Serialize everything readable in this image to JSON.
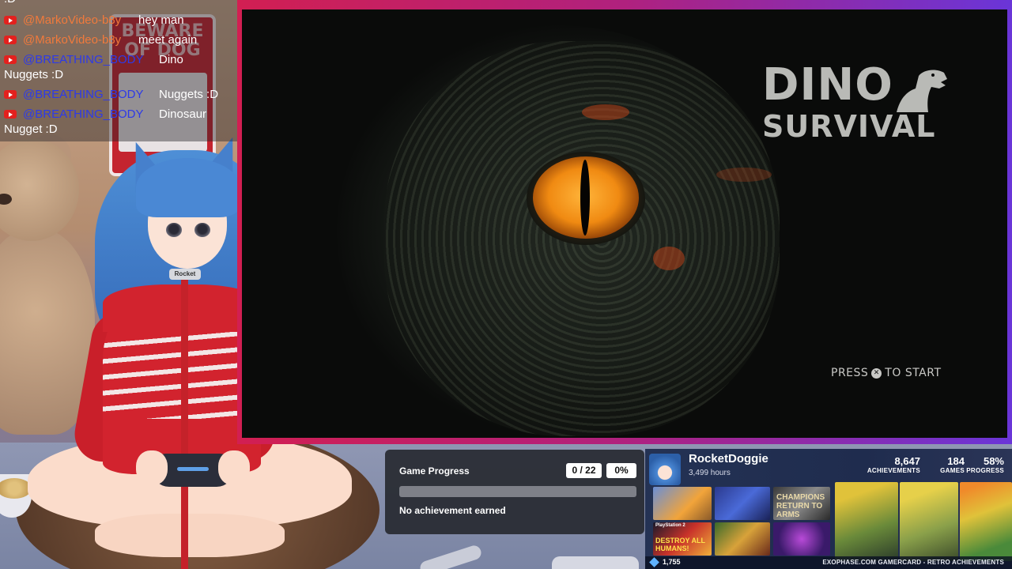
{
  "chat": {
    "messages": [
      {
        "author": "@MarkoVideo-b8y",
        "text": "hey man",
        "author_color": "orange"
      },
      {
        "author": "@MarkoVideo-b8y",
        "text": "meet again",
        "author_color": "orange"
      },
      {
        "author": "@BREATHING_BODY",
        "text": "Dino",
        "continuation": "Nuggets :D",
        "author_color": "blue"
      },
      {
        "author": "@BREATHING_BODY",
        "text": "Nuggets :D",
        "author_color": "blue"
      },
      {
        "author": "@BREATHING_BODY",
        "text": "Dinosaur",
        "continuation": "Nugget :D",
        "author_color": "blue"
      }
    ],
    "top_fragment": ":D",
    "icon": "youtube-icon"
  },
  "room": {
    "sign_text": "BEWARE OF DOG",
    "collar_tag": "Rocket"
  },
  "game": {
    "title_line1": "DINO",
    "title_line2": "SURVIVAL",
    "press_label": "PRESS",
    "start_label": "TO START",
    "button_icon": "cross-button-icon",
    "frame_colors": [
      "#d21f52",
      "#b0217e",
      "#6a35d8"
    ]
  },
  "progress": {
    "label": "Game Progress",
    "count": "0 / 22",
    "percent_label": "0%",
    "percent": 0,
    "status": "No achievement earned"
  },
  "gamercard": {
    "username": "RocketDoggie",
    "hours": "3,499 hours",
    "achievements": "8,647",
    "achievements_label": "ACHIEVEMENTS",
    "games": "184",
    "games_label": "GAMES",
    "progress": "58%",
    "progress_label": "PROGRESS",
    "tiles": [
      "CHAMPIONS RETURN TO ARMS",
      "PlayStation 2",
      "DESTROY ALL HUMANS!"
    ],
    "points": "1,755",
    "credit": "EXOPHASE.COM GAMERCARD - RETRO ACHIEVEMENTS"
  }
}
